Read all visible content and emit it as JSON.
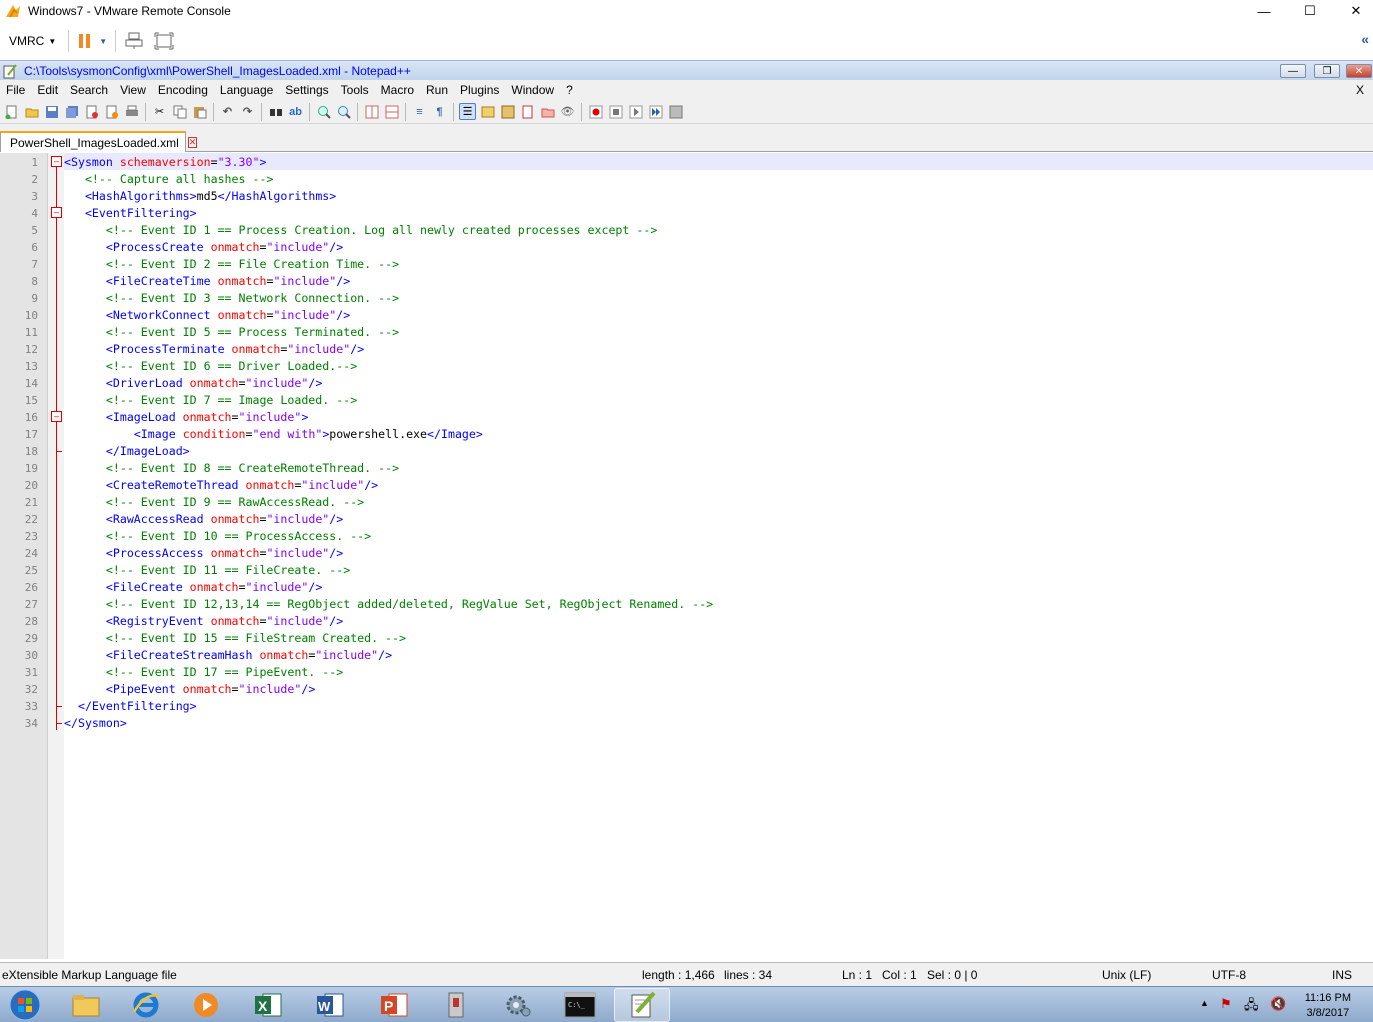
{
  "vm_window": {
    "title": "Windows7 - VMware Remote Console",
    "menu_label": "VMRC"
  },
  "np_window": {
    "title": "C:\\Tools\\sysmonConfig\\xml\\PowerShell_ImagesLoaded.xml - Notepad++"
  },
  "menu": [
    "File",
    "Edit",
    "Search",
    "View",
    "Encoding",
    "Language",
    "Settings",
    "Tools",
    "Macro",
    "Run",
    "Plugins",
    "Window",
    "?"
  ],
  "menu_close": "X",
  "tab": {
    "label": "PowerShell_ImagesLoaded.xml"
  },
  "editor": {
    "line_numbers": [
      "1",
      "2",
      "3",
      "4",
      "5",
      "6",
      "7",
      "8",
      "9",
      "10",
      "11",
      "12",
      "13",
      "14",
      "15",
      "16",
      "17",
      "18",
      "19",
      "20",
      "21",
      "22",
      "23",
      "24",
      "25",
      "26",
      "27",
      "28",
      "29",
      "30",
      "31",
      "32",
      "33",
      "34"
    ],
    "lines": [
      [
        [
          "t",
          "<Sysmon "
        ],
        [
          "a",
          "schemaversion"
        ],
        [
          "k",
          "="
        ],
        [
          "v",
          "\"3.30\""
        ],
        [
          "t",
          ">"
        ]
      ],
      [
        [
          "k",
          "   "
        ],
        [
          "c",
          "<!-- Capture all hashes -->"
        ]
      ],
      [
        [
          "k",
          "   "
        ],
        [
          "t",
          "<HashAlgorithms>"
        ],
        [
          "k",
          "md5"
        ],
        [
          "t",
          "</HashAlgorithms>"
        ]
      ],
      [
        [
          "k",
          "   "
        ],
        [
          "t",
          "<EventFiltering>"
        ]
      ],
      [
        [
          "k",
          "      "
        ],
        [
          "c",
          "<!-- Event ID 1 == Process Creation. Log all newly created processes except -->"
        ]
      ],
      [
        [
          "k",
          "      "
        ],
        [
          "t",
          "<ProcessCreate "
        ],
        [
          "a",
          "onmatch"
        ],
        [
          "k",
          "="
        ],
        [
          "v",
          "\"include\""
        ],
        [
          "t",
          "/>"
        ]
      ],
      [
        [
          "k",
          "      "
        ],
        [
          "c",
          "<!-- Event ID 2 == File Creation Time. -->"
        ]
      ],
      [
        [
          "k",
          "      "
        ],
        [
          "t",
          "<FileCreateTime "
        ],
        [
          "a",
          "onmatch"
        ],
        [
          "k",
          "="
        ],
        [
          "v",
          "\"include\""
        ],
        [
          "t",
          "/>"
        ]
      ],
      [
        [
          "k",
          "      "
        ],
        [
          "c",
          "<!-- Event ID 3 == Network Connection. -->"
        ]
      ],
      [
        [
          "k",
          "      "
        ],
        [
          "t",
          "<NetworkConnect "
        ],
        [
          "a",
          "onmatch"
        ],
        [
          "k",
          "="
        ],
        [
          "v",
          "\"include\""
        ],
        [
          "t",
          "/>"
        ]
      ],
      [
        [
          "k",
          "      "
        ],
        [
          "c",
          "<!-- Event ID 5 == Process Terminated. -->"
        ]
      ],
      [
        [
          "k",
          "      "
        ],
        [
          "t",
          "<ProcessTerminate "
        ],
        [
          "a",
          "onmatch"
        ],
        [
          "k",
          "="
        ],
        [
          "v",
          "\"include\""
        ],
        [
          "t",
          "/>"
        ]
      ],
      [
        [
          "k",
          "      "
        ],
        [
          "c",
          "<!-- Event ID 6 == Driver Loaded.-->"
        ]
      ],
      [
        [
          "k",
          "      "
        ],
        [
          "t",
          "<DriverLoad "
        ],
        [
          "a",
          "onmatch"
        ],
        [
          "k",
          "="
        ],
        [
          "v",
          "\"include\""
        ],
        [
          "t",
          "/>"
        ]
      ],
      [
        [
          "k",
          "      "
        ],
        [
          "c",
          "<!-- Event ID 7 == Image Loaded. -->"
        ]
      ],
      [
        [
          "k",
          "      "
        ],
        [
          "t",
          "<ImageLoad "
        ],
        [
          "a",
          "onmatch"
        ],
        [
          "k",
          "="
        ],
        [
          "v",
          "\"include\""
        ],
        [
          "t",
          ">"
        ]
      ],
      [
        [
          "k",
          "          "
        ],
        [
          "t",
          "<Image "
        ],
        [
          "a",
          "condition"
        ],
        [
          "k",
          "="
        ],
        [
          "v",
          "\"end with\""
        ],
        [
          "t",
          ">"
        ],
        [
          "k",
          "powershell.exe"
        ],
        [
          "t",
          "</Image>"
        ]
      ],
      [
        [
          "k",
          "      "
        ],
        [
          "t",
          "</ImageLoad>"
        ]
      ],
      [
        [
          "k",
          "      "
        ],
        [
          "c",
          "<!-- Event ID 8 == CreateRemoteThread. -->"
        ]
      ],
      [
        [
          "k",
          "      "
        ],
        [
          "t",
          "<CreateRemoteThread "
        ],
        [
          "a",
          "onmatch"
        ],
        [
          "k",
          "="
        ],
        [
          "v",
          "\"include\""
        ],
        [
          "t",
          "/>"
        ]
      ],
      [
        [
          "k",
          "      "
        ],
        [
          "c",
          "<!-- Event ID 9 == RawAccessRead. -->"
        ]
      ],
      [
        [
          "k",
          "      "
        ],
        [
          "t",
          "<RawAccessRead "
        ],
        [
          "a",
          "onmatch"
        ],
        [
          "k",
          "="
        ],
        [
          "v",
          "\"include\""
        ],
        [
          "t",
          "/>"
        ]
      ],
      [
        [
          "k",
          "      "
        ],
        [
          "c",
          "<!-- Event ID 10 == ProcessAccess. -->"
        ]
      ],
      [
        [
          "k",
          "      "
        ],
        [
          "t",
          "<ProcessAccess "
        ],
        [
          "a",
          "onmatch"
        ],
        [
          "k",
          "="
        ],
        [
          "v",
          "\"include\""
        ],
        [
          "t",
          "/>"
        ]
      ],
      [
        [
          "k",
          "      "
        ],
        [
          "c",
          "<!-- Event ID 11 == FileCreate. -->"
        ]
      ],
      [
        [
          "k",
          "      "
        ],
        [
          "t",
          "<FileCreate "
        ],
        [
          "a",
          "onmatch"
        ],
        [
          "k",
          "="
        ],
        [
          "v",
          "\"include\""
        ],
        [
          "t",
          "/>"
        ]
      ],
      [
        [
          "k",
          "      "
        ],
        [
          "c",
          "<!-- Event ID 12,13,14 == RegObject added/deleted, RegValue Set, RegObject Renamed. -->"
        ]
      ],
      [
        [
          "k",
          "      "
        ],
        [
          "t",
          "<RegistryEvent "
        ],
        [
          "a",
          "onmatch"
        ],
        [
          "k",
          "="
        ],
        [
          "v",
          "\"include\""
        ],
        [
          "t",
          "/>"
        ]
      ],
      [
        [
          "k",
          "      "
        ],
        [
          "c",
          "<!-- Event ID 15 == FileStream Created. -->"
        ]
      ],
      [
        [
          "k",
          "      "
        ],
        [
          "t",
          "<FileCreateStreamHash "
        ],
        [
          "a",
          "onmatch"
        ],
        [
          "k",
          "="
        ],
        [
          "v",
          "\"include\""
        ],
        [
          "t",
          "/>"
        ]
      ],
      [
        [
          "k",
          "      "
        ],
        [
          "c",
          "<!-- Event ID 17 == PipeEvent. -->"
        ]
      ],
      [
        [
          "k",
          "      "
        ],
        [
          "t",
          "<PipeEvent "
        ],
        [
          "a",
          "onmatch"
        ],
        [
          "k",
          "="
        ],
        [
          "v",
          "\"include\""
        ],
        [
          "t",
          "/>"
        ]
      ],
      [
        [
          "k",
          "  "
        ],
        [
          "t",
          "</EventFiltering>"
        ]
      ],
      [
        [
          "t",
          "</Sysmon>"
        ]
      ]
    ]
  },
  "status": {
    "file_type": "eXtensible Markup Language file",
    "length": "length : 1,466",
    "lines": "lines : 34",
    "ln": "Ln : 1",
    "col": "Col : 1",
    "sel": "Sel : 0 | 0",
    "eol": "Unix (LF)",
    "encoding": "UTF-8",
    "mode": "INS"
  },
  "taskbar": {
    "time": "11:16 PM",
    "date": "3/8/2017"
  },
  "colors": {
    "tag": "#0000ff",
    "attr": "#ff0000",
    "value": "#8000ff",
    "comment": "#008000",
    "fold": "#dd0000"
  }
}
